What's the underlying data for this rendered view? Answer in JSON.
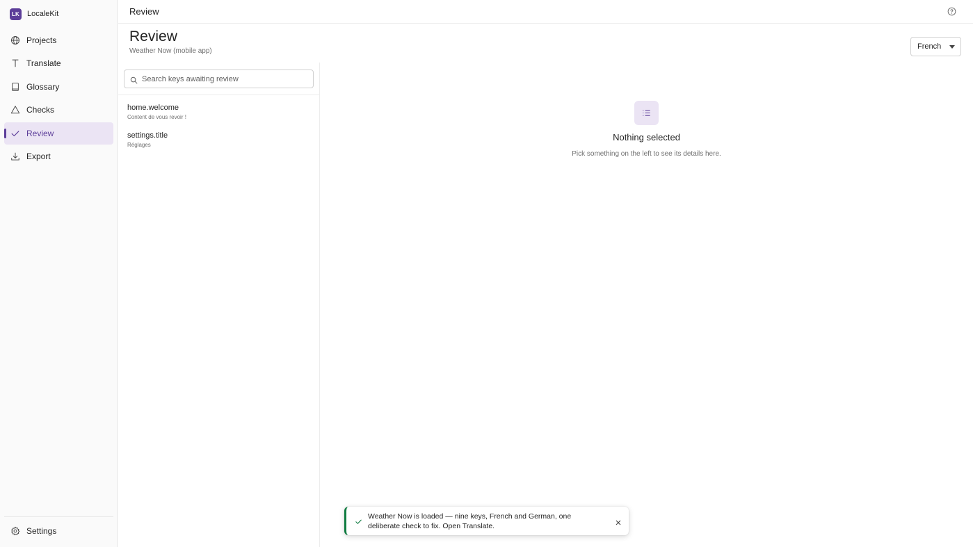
{
  "app": {
    "logo_text": "LK",
    "name": "LocaleKit"
  },
  "sidebar": {
    "items": [
      {
        "label": "Projects",
        "icon": "globe-icon"
      },
      {
        "label": "Translate",
        "icon": "text-icon"
      },
      {
        "label": "Glossary",
        "icon": "book-icon"
      },
      {
        "label": "Checks",
        "icon": "warning-icon"
      },
      {
        "label": "Review",
        "icon": "check-icon",
        "active": true
      },
      {
        "label": "Export",
        "icon": "download-icon"
      }
    ],
    "settings_label": "Settings"
  },
  "header": {
    "title": "Review"
  },
  "page": {
    "title": "Review",
    "subtitle": "Weather Now (mobile app)",
    "language": "French"
  },
  "search": {
    "placeholder": "Search keys awaiting review",
    "value": ""
  },
  "review_list": [
    {
      "key": "home.welcome",
      "value": "Content de vous revoir !"
    },
    {
      "key": "settings.title",
      "value": "Réglages"
    }
  ],
  "empty_state": {
    "title": "Nothing selected",
    "description": "Pick something on the left to see its details here."
  },
  "toast": {
    "message": "Weather Now is loaded — nine keys, French and German, one deliberate check to fix. Open Translate.",
    "accent": "#107c41"
  },
  "colors": {
    "brand": "#5c3d99",
    "active_bg": "#ebe4f4"
  }
}
